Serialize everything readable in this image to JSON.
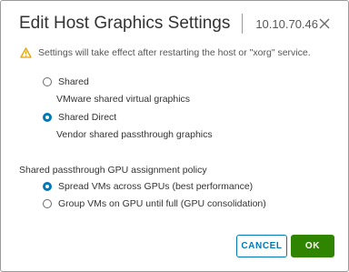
{
  "dialog": {
    "title": "Edit Host Graphics Settings",
    "host": "10.10.70.46",
    "close_icon": "close-icon"
  },
  "warning": {
    "icon": "warning-triangle-icon",
    "text": "Settings will take effect after restarting the host or \"xorg\" service."
  },
  "graphics_type": {
    "options": [
      {
        "label": "Shared",
        "description": "VMware shared virtual graphics",
        "selected": false
      },
      {
        "label": "Shared Direct",
        "description": "Vendor shared passthrough graphics",
        "selected": true
      }
    ]
  },
  "gpu_policy": {
    "title": "Shared passthrough GPU assignment policy",
    "options": [
      {
        "label": "Spread VMs across GPUs (best performance)",
        "selected": true
      },
      {
        "label": "Group VMs on GPU until full (GPU consolidation)",
        "selected": false
      }
    ]
  },
  "buttons": {
    "cancel": "CANCEL",
    "ok": "OK"
  },
  "colors": {
    "accent": "#0079b8",
    "primary_button": "#2f8400",
    "warning": "#e5a000"
  }
}
